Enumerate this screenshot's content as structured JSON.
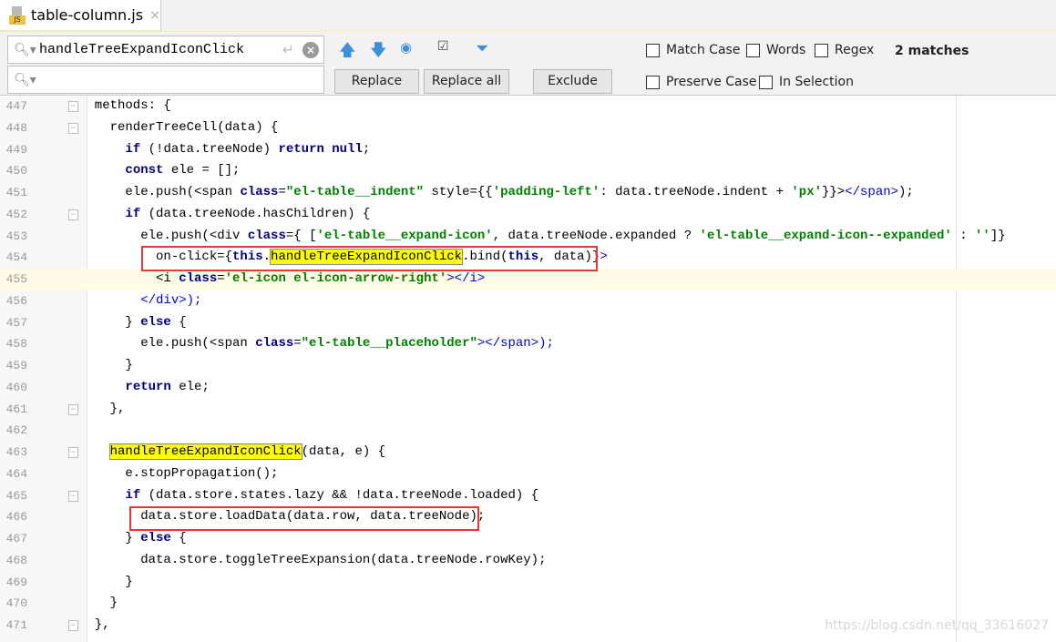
{
  "tab": {
    "title": "table-column.js",
    "icon_label": "JS",
    "close": "×"
  },
  "find": {
    "search_value": "handleTreeExpandIconClick",
    "replace_value": "",
    "matches": "2 matches",
    "buttons": {
      "replace": "Replace",
      "replace_all": "Replace all",
      "exclude": "Exclude"
    },
    "options": {
      "match_case": "Match Case",
      "words": "Words",
      "regex": "Regex",
      "preserve_case": "Preserve Case",
      "in_selection": "In Selection"
    }
  },
  "code": [
    {
      "n": "447",
      "fold": true,
      "tokens": [
        [
          "",
          "  methods: {"
        ]
      ]
    },
    {
      "n": "448",
      "fold": true,
      "tokens": [
        [
          "",
          "    renderTreeCell(data) {"
        ]
      ]
    },
    {
      "n": "449",
      "tokens": [
        [
          "",
          "      "
        ],
        [
          "k",
          "if"
        ],
        [
          "",
          " (!data.treeNode) "
        ],
        [
          "k",
          "return null"
        ],
        [
          "",
          ";"
        ]
      ]
    },
    {
      "n": "450",
      "tokens": [
        [
          "",
          "      "
        ],
        [
          "k",
          "const"
        ],
        [
          "",
          " ele = [];"
        ]
      ]
    },
    {
      "n": "451",
      "tokens": [
        [
          "",
          "      ele.push(<span "
        ],
        [
          "k",
          "class"
        ],
        [
          "",
          "="
        ],
        [
          "s",
          "\"el-table__indent\""
        ],
        [
          "",
          " style={{"
        ],
        [
          "s",
          "'padding-left'"
        ],
        [
          "",
          ": data.treeNode.indent + "
        ],
        [
          "s",
          "'px'"
        ],
        [
          "",
          "}}>"
        ],
        [
          "t",
          "</span>"
        ],
        [
          "",
          ");"
        ]
      ]
    },
    {
      "n": "452",
      "fold": true,
      "tokens": [
        [
          "",
          "      "
        ],
        [
          "k",
          "if"
        ],
        [
          "",
          " (data.treeNode.hasChildren) {"
        ]
      ]
    },
    {
      "n": "453",
      "tokens": [
        [
          "",
          "        ele.push(<div "
        ],
        [
          "k",
          "class"
        ],
        [
          "",
          "={ ["
        ],
        [
          "s",
          "'el-table__expand-icon'"
        ],
        [
          "",
          ", data.treeNode.expanded ? "
        ],
        [
          "s",
          "'el-table__expand-icon--expanded'"
        ],
        [
          "",
          " : "
        ],
        [
          "s",
          "''"
        ],
        [
          "",
          "]}"
        ]
      ]
    },
    {
      "n": "454",
      "tokens": [
        [
          "",
          "          on-click={"
        ],
        [
          "k",
          "this"
        ],
        [
          "",
          "."
        ],
        [
          "hl",
          "handleTreeExpandIconClick"
        ],
        [
          "",
          ".bind("
        ],
        [
          "k",
          "this"
        ],
        [
          "",
          ", data)}"
        ],
        [
          "t",
          ">"
        ]
      ]
    },
    {
      "n": "455",
      "cur": true,
      "tokens": [
        [
          "",
          "          <i "
        ],
        [
          "k",
          "class"
        ],
        [
          "",
          "="
        ],
        [
          "s",
          "'el-icon el-icon-arrow-right'"
        ],
        [
          "t",
          "></i>"
        ]
      ]
    },
    {
      "n": "456",
      "tokens": [
        [
          "",
          "        "
        ],
        [
          "t",
          "</div>"
        ],
        [
          "t",
          ");"
        ]
      ]
    },
    {
      "n": "457",
      "tokens": [
        [
          "",
          "      } "
        ],
        [
          "k",
          "else"
        ],
        [
          "",
          " {"
        ]
      ]
    },
    {
      "n": "458",
      "tokens": [
        [
          "",
          "        ele.push(<span "
        ],
        [
          "k",
          "class"
        ],
        [
          "",
          "="
        ],
        [
          "s",
          "\"el-table__placeholder\""
        ],
        [
          "t",
          "></span>"
        ],
        [
          "t",
          ");"
        ]
      ]
    },
    {
      "n": "459",
      "tokens": [
        [
          "",
          "      }"
        ]
      ]
    },
    {
      "n": "460",
      "tokens": [
        [
          "",
          "      "
        ],
        [
          "k",
          "return"
        ],
        [
          "",
          " ele;"
        ]
      ]
    },
    {
      "n": "461",
      "fold": true,
      "tokens": [
        [
          "",
          "    },"
        ]
      ]
    },
    {
      "n": "462",
      "tokens": [
        [
          "",
          ""
        ]
      ]
    },
    {
      "n": "463",
      "fold": true,
      "tokens": [
        [
          "",
          "    "
        ],
        [
          "hl",
          "handleTreeExpandIconClick"
        ],
        [
          "",
          "(data, e) {"
        ]
      ]
    },
    {
      "n": "464",
      "tokens": [
        [
          "",
          "      e.stopPropagation();"
        ]
      ]
    },
    {
      "n": "465",
      "fold": true,
      "tokens": [
        [
          "",
          "      "
        ],
        [
          "k",
          "if"
        ],
        [
          "",
          " (data.store.states.lazy && !data.treeNode.loaded) {"
        ]
      ]
    },
    {
      "n": "466",
      "tokens": [
        [
          "",
          "        data.store.loadData(data.row, data.treeNode);"
        ]
      ]
    },
    {
      "n": "467",
      "tokens": [
        [
          "",
          "      } "
        ],
        [
          "k",
          "else"
        ],
        [
          "",
          " {"
        ]
      ]
    },
    {
      "n": "468",
      "tokens": [
        [
          "",
          "        data.store.toggleTreeExpansion(data.treeNode.rowKey);"
        ]
      ]
    },
    {
      "n": "469",
      "tokens": [
        [
          "",
          "      }"
        ]
      ]
    },
    {
      "n": "470",
      "tokens": [
        [
          "",
          "    }"
        ]
      ]
    },
    {
      "n": "471",
      "fold": true,
      "tokens": [
        [
          "",
          "  },"
        ]
      ]
    }
  ],
  "watermark": "https://blog.csdn.net/qq_33616027",
  "colors": {
    "keyword": "#000080",
    "string": "#008000",
    "highlight": "#ffff00",
    "annotation_box": "#e53935"
  }
}
